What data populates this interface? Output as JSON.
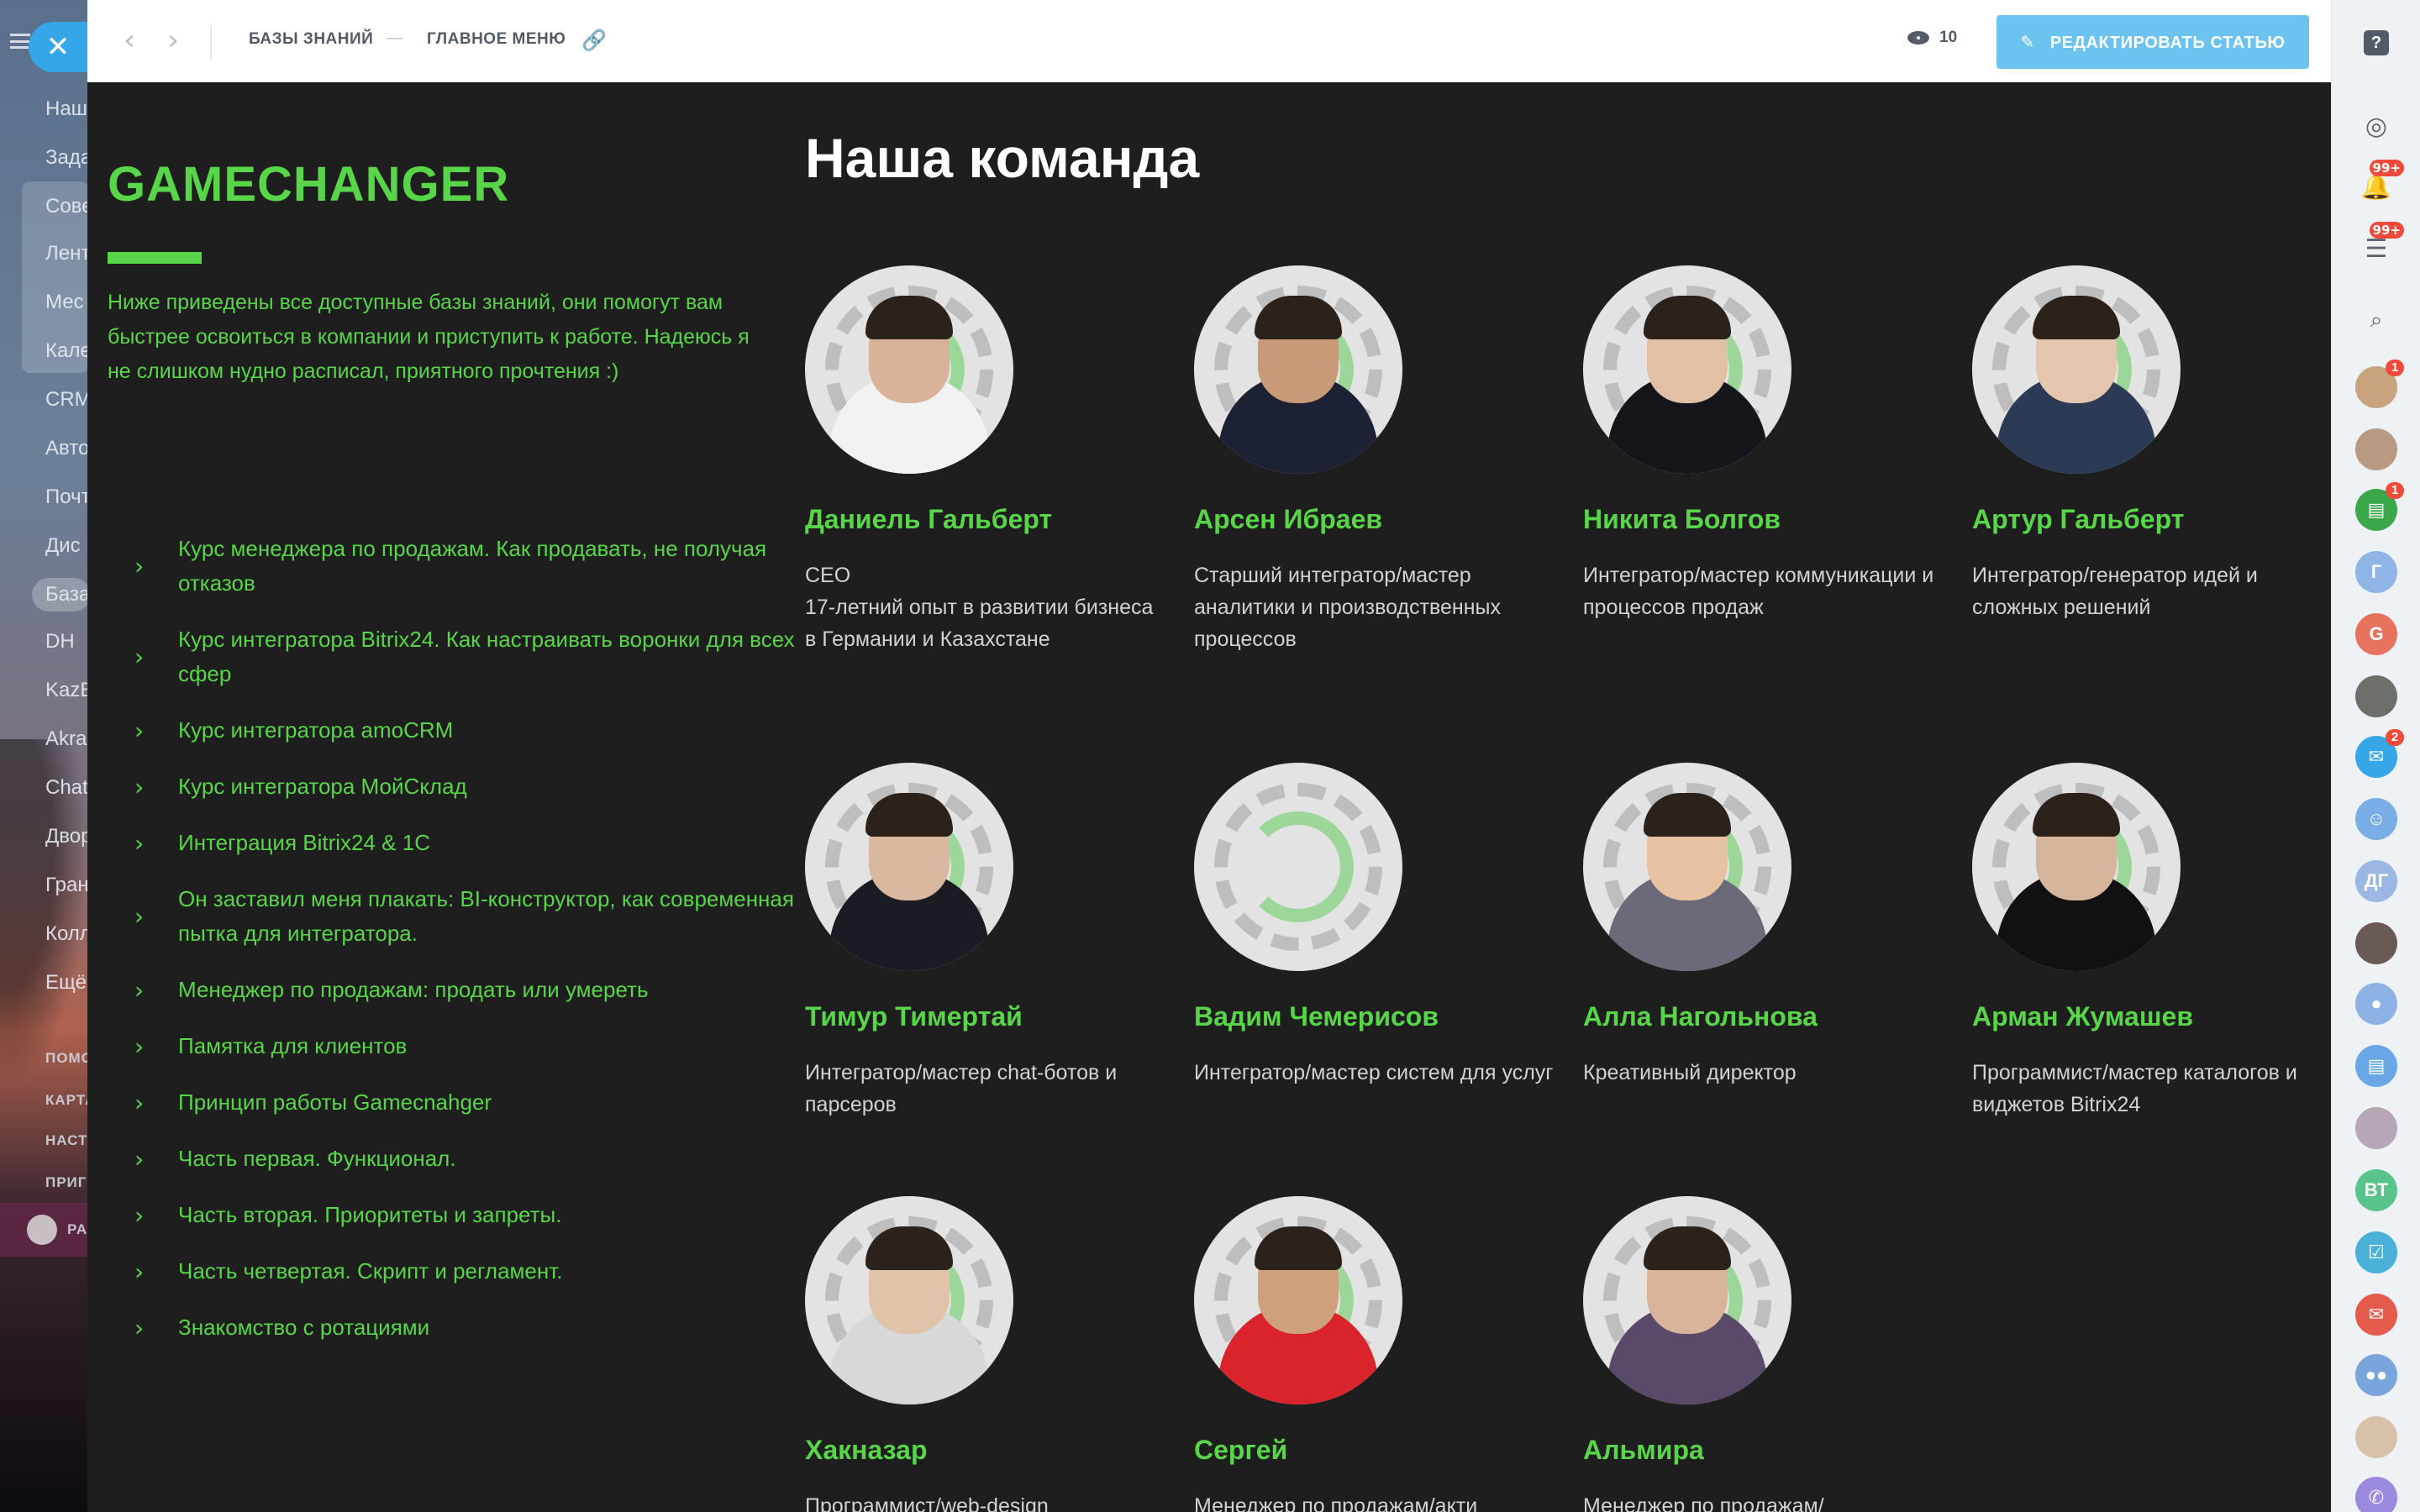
{
  "left_sidebar": {
    "items": [
      "Наш",
      "Зада",
      "Сове",
      "Лент",
      "Мес",
      "Кале",
      "CRM",
      "Авто",
      "Почт",
      "Дис",
      "База",
      "DH",
      "KazE",
      "Akra",
      "Chat",
      "Двор",
      "Гран",
      "Колл",
      "Ещё"
    ],
    "small_items": [
      "ПОМО",
      "КАРТА",
      "НАСТ",
      "ПРИГ"
    ],
    "bottom_label": "РА"
  },
  "topbar": {
    "back_icon": "chevron-left-icon",
    "forward_icon": "chevron-right-icon",
    "crumb1": "БАЗЫ ЗНАНИЙ",
    "separator": "—",
    "crumb2": "ГЛАВНОЕ МЕНЮ",
    "views": "10",
    "edit_label": "РЕДАКТИРОВАТЬ СТАТЬЮ",
    "accent": "#6cc3ef"
  },
  "article": {
    "brand": "GAMECHANGER",
    "intro": "Ниже приведены все доступные базы знаний, они помогут вам быстрее освоиться в компании и приступить к работе. Надеюсь я не слишком нудно расписал, приятного прочтения :)",
    "toc": [
      "Курс менеджера по продажам. Как продавать, не получая отказов",
      "Курс интегратора Bitrix24. Как настраивать воронки для всех сфер",
      "Курс интегратора amoCRM",
      "Курс интегратора МойСклад",
      "Интеграция Bitrix24 & 1С",
      "Он заставил меня плакать: BI-конструктор, как современная пытка для интегратора.",
      "Менеджер по продажам: продать или умереть",
      "Памятка для клиентов",
      "Принцип работы Gamecnahger",
      "Часть первая. Функционал.",
      "Часть вторая. Приоритеты и запреты.",
      "Часть четвертая. Скрипт и регламент.",
      "Знакомство с ротациями"
    ],
    "team_title": "Наша команда",
    "team": [
      {
        "name": "Даниель Гальберт",
        "role": "CEO\n17-летний опыт в развитии бизнеса в Германии и Казахстане"
      },
      {
        "name": "Арсен Ибраев",
        "role": "Старший интегратор/мастер аналитики и производственных процессов"
      },
      {
        "name": "Никита Болгов",
        "role": "Интегратор/мастер коммуникации и процессов продаж"
      },
      {
        "name": "Артур Гальберт",
        "role": "Интегратор/генератор идей и сложных решений"
      },
      {
        "name": "Тимур Тимертай",
        "role": "Интегратор/мастер chat-ботов и парсеров"
      },
      {
        "name": "Вадим Чемерисов",
        "role": "Интегратор/мастер систем для услуг"
      },
      {
        "name": "Алла Нагольнова",
        "role": "Креативный директор"
      },
      {
        "name": "Арман Жумашев",
        "role": "Программист/мастер каталогов и виджетов Bitrix24"
      },
      {
        "name": "Хакназар",
        "role": "Программист/web-design"
      },
      {
        "name": "Сергей",
        "role": "Менеджер по продажам/акти"
      },
      {
        "name": "Альмира",
        "role": "Менеджер по продажам/"
      }
    ],
    "accent": "#58d548"
  },
  "right_rail": {
    "help": "?",
    "badges": [
      "99+",
      "99+",
      "1",
      "1",
      "2"
    ],
    "letters": [
      "Г",
      "G",
      "ДГ",
      "ВТ"
    ]
  }
}
